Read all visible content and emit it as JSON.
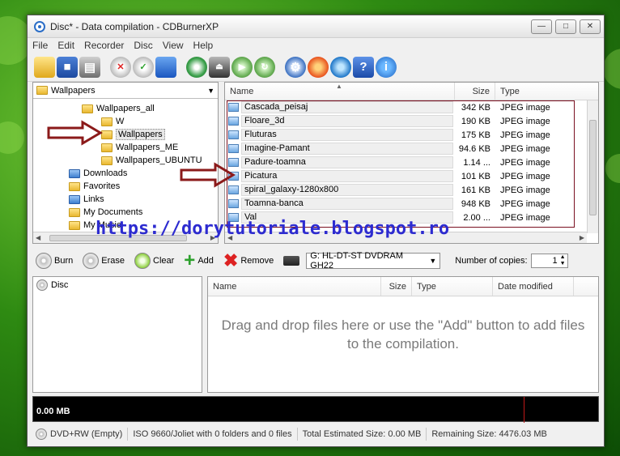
{
  "window": {
    "title": "Disc* - Data compilation - CDBurnerXP"
  },
  "menu": [
    "File",
    "Edit",
    "Recorder",
    "Disc",
    "View",
    "Help"
  ],
  "toolbar": {
    "icons": [
      "new-folder-icon",
      "save-icon",
      "print-icon",
      "erase-disc-icon",
      "verify-disc-icon",
      "info-blue-icon",
      "disc-tools-icon",
      "eject-icon",
      "disc-forward-icon",
      "disc-refresh-icon",
      "settings-icon",
      "burn-flame-icon",
      "globe-search-icon",
      "help-icon",
      "about-icon"
    ]
  },
  "tree": {
    "combo_value": "Wallpapers",
    "items": [
      {
        "label": "Wallpapers_all"
      },
      {
        "label": "W"
      },
      {
        "label": "Wallpapers"
      },
      {
        "label": "Wallpapers_ME"
      },
      {
        "label": "Wallpapers_UBUNTU"
      },
      {
        "label": "Downloads"
      },
      {
        "label": "Favorites"
      },
      {
        "label": "Links"
      },
      {
        "label": "My Documents"
      },
      {
        "label": "My Music"
      }
    ]
  },
  "file_list": {
    "columns": {
      "name": "Name",
      "size": "Size",
      "type": "Type"
    },
    "rows": [
      {
        "name": "Cascada_peisaj",
        "size": "342 KB",
        "type": "JPEG image"
      },
      {
        "name": "Floare_3d",
        "size": "190 KB",
        "type": "JPEG image"
      },
      {
        "name": "Fluturas",
        "size": "175 KB",
        "type": "JPEG image"
      },
      {
        "name": "Imagine-Pamant",
        "size": "94.6 KB",
        "type": "JPEG image"
      },
      {
        "name": "Padure-toamna",
        "size": "1.14 ...",
        "type": "JPEG image"
      },
      {
        "name": "Picatura",
        "size": "101 KB",
        "type": "JPEG image"
      },
      {
        "name": "spiral_galaxy-1280x800",
        "size": "161 KB",
        "type": "JPEG image"
      },
      {
        "name": "Toamna-banca",
        "size": "948 KB",
        "type": "JPEG image"
      },
      {
        "name": "Val",
        "size": "2.00 ...",
        "type": "JPEG image"
      }
    ]
  },
  "watermark": "https://dorytutoriale.blogspot.ro",
  "actions": {
    "burn": "Burn",
    "erase": "Erase",
    "clear": "Clear",
    "add": "Add",
    "remove": "Remove",
    "drive": "G: HL-DT-ST DVDRAM GH22",
    "copies_label": "Number of copies:",
    "copies_value": "1"
  },
  "disc_tree": {
    "root": "Disc"
  },
  "compilation": {
    "columns": {
      "name": "Name",
      "size": "Size",
      "type": "Type",
      "date": "Date modified"
    },
    "hint": "Drag and drop files here or use the \"Add\" button to add files to the compilation."
  },
  "meter": {
    "label": "0.00 MB"
  },
  "status": {
    "disc": "DVD+RW (Empty)",
    "fs": "ISO 9660/Joliet with 0 folders and 0 files",
    "total": "Total Estimated Size: 0.00 MB",
    "remaining": "Remaining Size: 4476.03 MB"
  },
  "colors": {
    "watermark": "#2d2bd0",
    "arrow": "#8b1a1a",
    "selection_box": "#7a1020"
  }
}
